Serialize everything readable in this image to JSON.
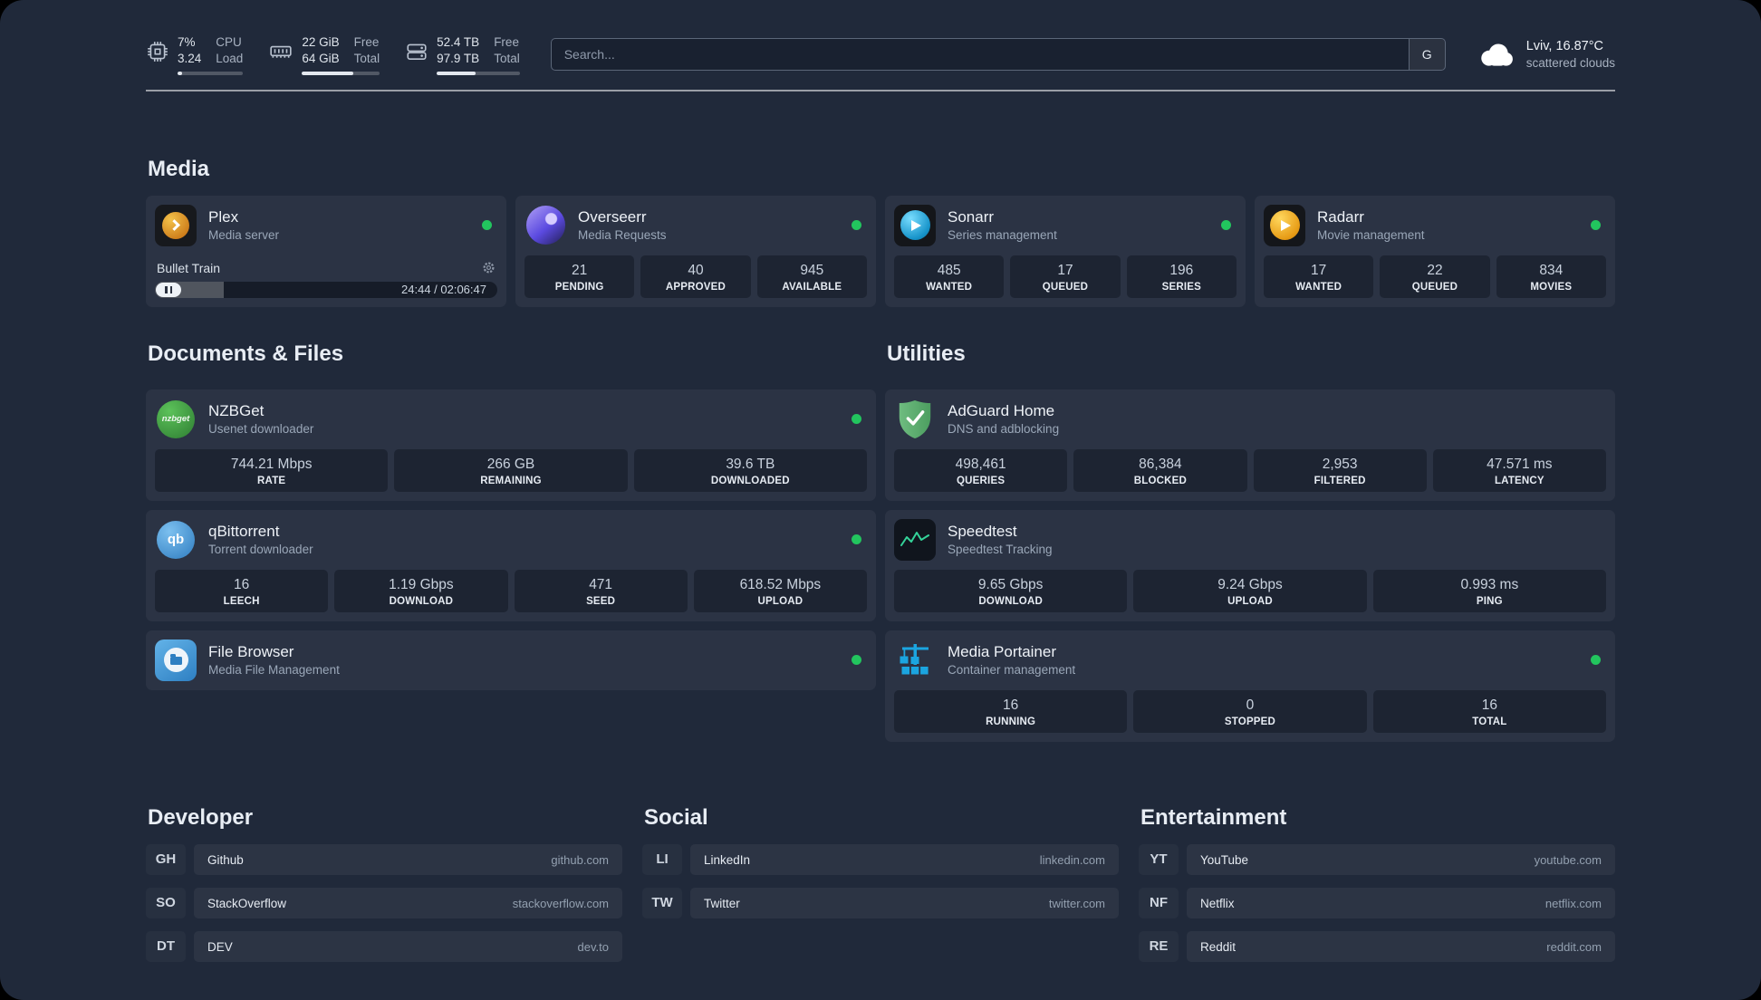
{
  "topbar": {
    "cpu": {
      "value1": "7%",
      "value2": "3.24",
      "label1": "CPU",
      "label2": "Load"
    },
    "ram": {
      "value1": "22 GiB",
      "value2": "64 GiB",
      "label1": "Free",
      "label2": "Total"
    },
    "disk": {
      "value1": "52.4 TB",
      "value2": "97.9 TB",
      "label1": "Free",
      "label2": "Total"
    },
    "search": {
      "placeholder": "Search...",
      "button_label": "G"
    },
    "weather": {
      "location": "Lviv, 16.87°C",
      "condition": "scattered clouds"
    }
  },
  "sections": {
    "media": "Media",
    "documents": "Documents & Files",
    "utilities": "Utilities",
    "developer": "Developer",
    "social": "Social",
    "entertainment": "Entertainment"
  },
  "icons": {
    "nzbget_label": "nzbget",
    "qbittorrent_label": "qb"
  },
  "services": {
    "plex": {
      "title": "Plex",
      "subtitle": "Media server",
      "status": "online",
      "player": {
        "track": "Bullet Train",
        "time": "24:44 / 02:06:47"
      }
    },
    "overseerr": {
      "title": "Overseerr",
      "subtitle": "Media Requests",
      "status": "online",
      "stats": [
        {
          "value": "21",
          "label": "PENDING"
        },
        {
          "value": "40",
          "label": "APPROVED"
        },
        {
          "value": "945",
          "label": "AVAILABLE"
        }
      ]
    },
    "sonarr": {
      "title": "Sonarr",
      "subtitle": "Series management",
      "status": "online",
      "stats": [
        {
          "value": "485",
          "label": "WANTED"
        },
        {
          "value": "17",
          "label": "QUEUED"
        },
        {
          "value": "196",
          "label": "SERIES"
        }
      ]
    },
    "radarr": {
      "title": "Radarr",
      "subtitle": "Movie management",
      "status": "online",
      "stats": [
        {
          "value": "17",
          "label": "WANTED"
        },
        {
          "value": "22",
          "label": "QUEUED"
        },
        {
          "value": "834",
          "label": "MOVIES"
        }
      ]
    },
    "nzbget": {
      "title": "NZBGet",
      "subtitle": "Usenet downloader",
      "status": "online",
      "stats": [
        {
          "value": "744.21 Mbps",
          "label": "RATE"
        },
        {
          "value": "266 GB",
          "label": "REMAINING"
        },
        {
          "value": "39.6 TB",
          "label": "DOWNLOADED"
        }
      ]
    },
    "qbittorrent": {
      "title": "qBittorrent",
      "subtitle": "Torrent downloader",
      "status": "online",
      "stats": [
        {
          "value": "16",
          "label": "LEECH"
        },
        {
          "value": "1.19 Gbps",
          "label": "DOWNLOAD"
        },
        {
          "value": "471",
          "label": "SEED"
        },
        {
          "value": "618.52 Mbps",
          "label": "UPLOAD"
        }
      ]
    },
    "filebrowser": {
      "title": "File Browser",
      "subtitle": "Media File Management",
      "status": "online"
    },
    "adguard": {
      "title": "AdGuard Home",
      "subtitle": "DNS and adblocking",
      "stats": [
        {
          "value": "498,461",
          "label": "QUERIES"
        },
        {
          "value": "86,384",
          "label": "BLOCKED"
        },
        {
          "value": "2,953",
          "label": "FILTERED"
        },
        {
          "value": "47.571 ms",
          "label": "LATENCY"
        }
      ]
    },
    "speedtest": {
      "title": "Speedtest",
      "subtitle": "Speedtest Tracking",
      "stats": [
        {
          "value": "9.65 Gbps",
          "label": "DOWNLOAD"
        },
        {
          "value": "9.24 Gbps",
          "label": "UPLOAD"
        },
        {
          "value": "0.993 ms",
          "label": "PING"
        }
      ]
    },
    "portainer": {
      "title": "Media Portainer",
      "subtitle": "Container management",
      "status": "online",
      "stats": [
        {
          "value": "16",
          "label": "RUNNING"
        },
        {
          "value": "0",
          "label": "STOPPED"
        },
        {
          "value": "16",
          "label": "TOTAL"
        }
      ]
    }
  },
  "bookmarks": {
    "developer": [
      {
        "abbr": "GH",
        "name": "Github",
        "domain": "github.com"
      },
      {
        "abbr": "SO",
        "name": "StackOverflow",
        "domain": "stackoverflow.com"
      },
      {
        "abbr": "DT",
        "name": "DEV",
        "domain": "dev.to"
      }
    ],
    "social": [
      {
        "abbr": "LI",
        "name": "LinkedIn",
        "domain": "linkedin.com"
      },
      {
        "abbr": "TW",
        "name": "Twitter",
        "domain": "twitter.com"
      }
    ],
    "entertainment": [
      {
        "abbr": "YT",
        "name": "YouTube",
        "domain": "youtube.com"
      },
      {
        "abbr": "NF",
        "name": "Netflix",
        "domain": "netflix.com"
      },
      {
        "abbr": "RE",
        "name": "Reddit",
        "domain": "reddit.com"
      }
    ]
  },
  "colors": {
    "status_online": "#22c55e"
  }
}
